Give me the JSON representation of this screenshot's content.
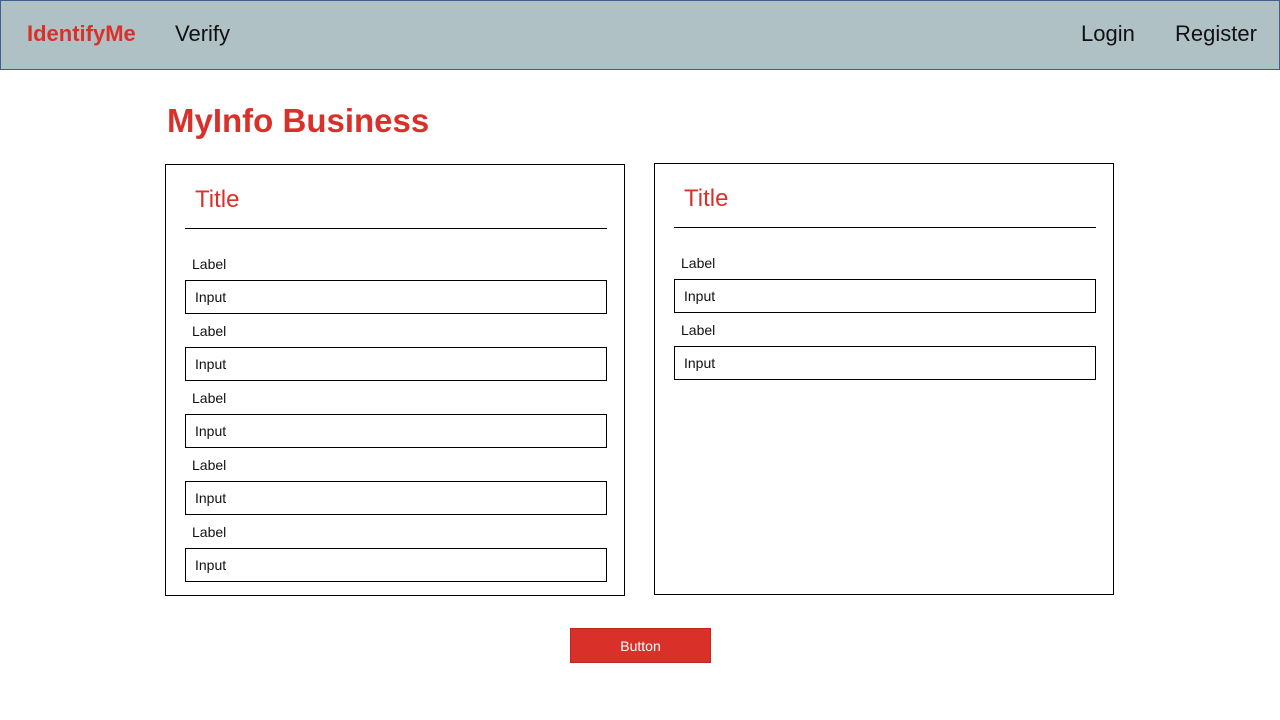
{
  "navbar": {
    "brand": "IdentifyMe",
    "links": [
      "Verify"
    ],
    "right_links": [
      "Login",
      "Register"
    ]
  },
  "page": {
    "title": "MyInfo Business"
  },
  "cards": [
    {
      "title": "Title",
      "fields": [
        {
          "label": "Label",
          "placeholder": "Input"
        },
        {
          "label": "Label",
          "placeholder": "Input"
        },
        {
          "label": "Label",
          "placeholder": "Input"
        },
        {
          "label": "Label",
          "placeholder": "Input"
        },
        {
          "label": "Label",
          "placeholder": "Input"
        }
      ]
    },
    {
      "title": "Title",
      "fields": [
        {
          "label": "Label",
          "placeholder": "Input"
        },
        {
          "label": "Label",
          "placeholder": "Input"
        }
      ]
    }
  ],
  "actions": {
    "button_label": "Button"
  },
  "colors": {
    "accent": "#d9312a",
    "navbar_bg": "#b0c1c6",
    "navbar_border": "#3f5f8f"
  }
}
